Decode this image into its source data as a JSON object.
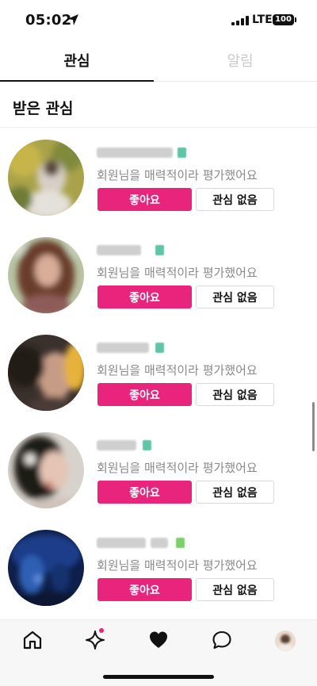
{
  "status_bar": {
    "time": "05:02",
    "network": "LTE",
    "battery": "100"
  },
  "tabs": [
    {
      "label": "관심",
      "active": true
    },
    {
      "label": "알림",
      "active": false
    }
  ],
  "section": {
    "title": "받은 관심"
  },
  "likes": [
    {
      "message": "회원님을 매력적이라 평가했어요",
      "like_label": "좋아요",
      "pass_label": "관심 없음"
    },
    {
      "message": "회원님을 매력적이라 평가했어요",
      "like_label": "좋아요",
      "pass_label": "관심 없음"
    },
    {
      "message": "회원님을 매력적이라 평가했어요",
      "like_label": "좋아요",
      "pass_label": "관심 없음"
    },
    {
      "message": "회원님을 매력적이라 평가했어요",
      "like_label": "좋아요",
      "pass_label": "관심 없음"
    },
    {
      "message": "회원님을 매력적이라 평가했어요",
      "like_label": "좋아요",
      "pass_label": "관심 없음"
    }
  ],
  "bottom_nav": {
    "items": [
      "home-icon",
      "sparkle-icon",
      "heart-icon",
      "chat-bubble-icon",
      "profile-avatar"
    ],
    "active": "heart-icon"
  },
  "colors": {
    "accent": "#e8247c",
    "inactive_tab": "#c9c9c9",
    "message_text": "#8a8a8a"
  }
}
